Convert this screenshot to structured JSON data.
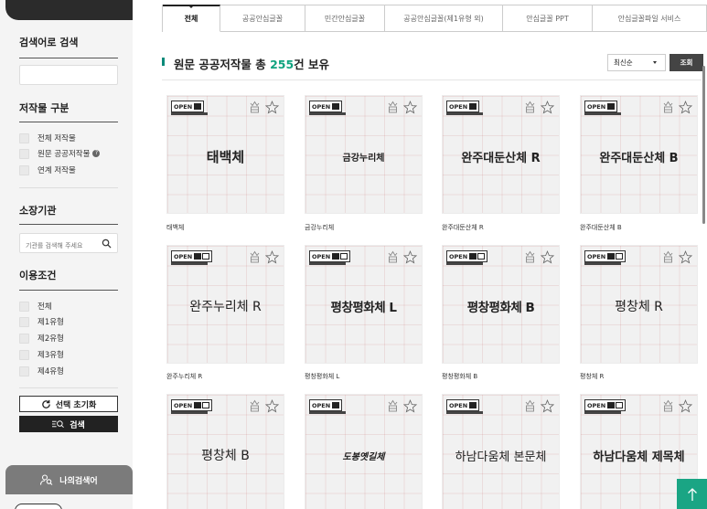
{
  "sidebar": {
    "keyword_title": "검색어로 검색",
    "keyword_value": "",
    "type_title": "저작물 구분",
    "type_options": [
      "전체 저작물",
      "원문 공공저작물",
      "연계 저작물"
    ],
    "org_title": "소장기관",
    "org_placeholder": "기관를 검색해 주세요",
    "condition_title": "이용조건",
    "condition_options": [
      "전체",
      "제1유형",
      "제2유형",
      "제3유형",
      "제4유형"
    ],
    "reset_label": "선택 초기화",
    "search_label": "검색",
    "my_keyword_label": "나의검색어"
  },
  "tabs": [
    {
      "label": "전체",
      "active": true
    },
    {
      "label": "공공안심글꼴",
      "active": false
    },
    {
      "label": "민간안심글꼴",
      "active": false
    },
    {
      "label": "공공안심글꼴(제1유형 외)",
      "active": false
    },
    {
      "label": "안심글꼴 PPT",
      "active": false
    },
    {
      "label": "안심글꼴파일 서비스",
      "active": false
    }
  ],
  "heading": {
    "prefix": "원문 공공저작물 총 ",
    "count": "255",
    "suffix": "건 보유"
  },
  "sort": {
    "selected": "최신순",
    "button_label": "조회"
  },
  "cards": [
    {
      "sample": "태백체",
      "label": "태백체"
    },
    {
      "sample": "금강누리체",
      "label": "금강누리체"
    },
    {
      "sample": "완주대둔산체 R",
      "label": "완주대둔산체 R"
    },
    {
      "sample": "완주대둔산체 B",
      "label": "완주대둔산체 B"
    },
    {
      "sample": "완주누리체 R",
      "label": "완주누리체 R"
    },
    {
      "sample": "평창평화체 L",
      "label": "평창평화체 L"
    },
    {
      "sample": "평창평화체 B",
      "label": "평창평화체 B"
    },
    {
      "sample": "평창체 R",
      "label": "평창체 R"
    },
    {
      "sample": "평창체 B",
      "label": "평창체 B"
    },
    {
      "sample": "도봉옛길체",
      "label": ""
    },
    {
      "sample": "하남다움체 본문체",
      "label": ""
    },
    {
      "sample": "하남다움체 제목체",
      "label": ""
    }
  ],
  "badge": {
    "open_text": "OPEN"
  },
  "colors": {
    "accent": "#10a37f",
    "top_button": "#1aa584",
    "dark": "#222222"
  }
}
